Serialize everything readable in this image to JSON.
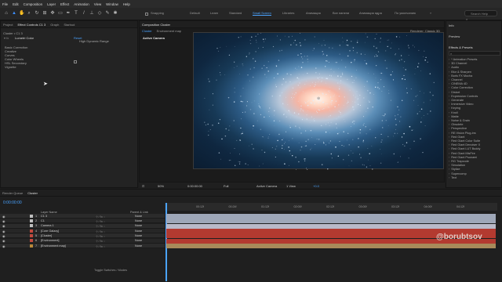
{
  "menubar": [
    "File",
    "Edit",
    "Composition",
    "Layer",
    "Effect",
    "Animation",
    "View",
    "Window",
    "Help"
  ],
  "toolbar": {
    "snapping_label": "Snapping",
    "workspaces": [
      "Default",
      "Learn",
      "Standard",
      "Small Screen",
      "Libraries",
      "Анимация",
      "Все панели",
      "Анимация ядра",
      "По умолчанию"
    ],
    "active_workspace": "Small Screen",
    "search_placeholder": "Search Help"
  },
  "project_panel": {
    "tabs": [
      "Project",
      "Effect Controls C1 3",
      "Graph",
      "Starbud"
    ],
    "layer_path": "Cluster • C1 3",
    "effect_name": "Lumetri Color",
    "reset_label": "Reset",
    "hdr_label": "High Dynamic Range",
    "sections": [
      "Basic Correction",
      "Creative",
      "Curves",
      "Color Wheels",
      "HSL Secondary",
      "Vignette"
    ]
  },
  "viewer": {
    "tab_title": "Composition Cluster",
    "tabs": [
      "Cluster",
      "Environment map"
    ],
    "active_camera": "Active Camera",
    "renderer_label": "Renderer: Classic 3D",
    "zoom": "50%",
    "timecode": "0:00:00:00",
    "resolution": "Full",
    "camera_select": "Active Camera",
    "view_select": "1 View",
    "exposure": "+0.0"
  },
  "right_panels": {
    "info_label": "Info",
    "preview_label": "Preview",
    "effects_title": "Effects & Presets",
    "search_value": "",
    "items": [
      "* Animation Presets",
      "3D Channel",
      "Audio",
      "Blur & Sharpen",
      "Boris FX Mocha",
      "Channel",
      "CINEMA 4D",
      "Color Correction",
      "Distort",
      "Expression Controls",
      "Generate",
      "Immersive Video",
      "Keying",
      "Knoll",
      "Matte",
      "Noise & Grain",
      "Obsolete",
      "Perspective",
      "RE:Vision Plug-ins",
      "Red Giant",
      "Red Giant Color Suite",
      "Red Giant Denoiser II",
      "Red Giant LUT Buddy",
      "Red Giant MisFire",
      "Red Giant Psunami",
      "RG Trapcode",
      "Simulation",
      "Stylize",
      "Supercomp",
      "Text"
    ]
  },
  "timeline": {
    "tabs": [
      "Render Queue",
      "Cluster"
    ],
    "timecode": "0:00:00:00",
    "col_source": "Layer Name",
    "col_parent": "Parent & Link",
    "layers": [
      {
        "num": "1",
        "name": "C1 3",
        "color": "#c0c0c0",
        "parent": "None",
        "bar": "#9ea7b8"
      },
      {
        "num": "2",
        "name": "C1",
        "color": "#c0c0c0",
        "parent": "None",
        "bar": "#9ea7b8"
      },
      {
        "num": "3",
        "name": "Camera 1",
        "color": "#c0c0c0",
        "parent": "None",
        "bar": "#b9b9c8"
      },
      {
        "num": "4",
        "name": "[Core Galaxy]",
        "color": "#c34a3e",
        "parent": "None",
        "bar": "#b33a30"
      },
      {
        "num": "5",
        "name": "[Cluster]",
        "color": "#c34a3e",
        "parent": "None",
        "bar": "#b33a30"
      },
      {
        "num": "6",
        "name": "[Environment]",
        "color": "#c34a3e",
        "parent": "None",
        "bar": "#b33a30"
      },
      {
        "num": "7",
        "name": "[Environment map]",
        "color": "#b9893a",
        "parent": "None",
        "bar": "#a88a5a"
      }
    ],
    "ruler_ticks": [
      "00:12f",
      "00:24f",
      "01:12f",
      "02:00f",
      "02:12f",
      "03:00f",
      "03:12f",
      "04:00f",
      "04:12f"
    ],
    "toggle_label": "Toggle Switches / Modes"
  },
  "watermark": "@borubtsov"
}
